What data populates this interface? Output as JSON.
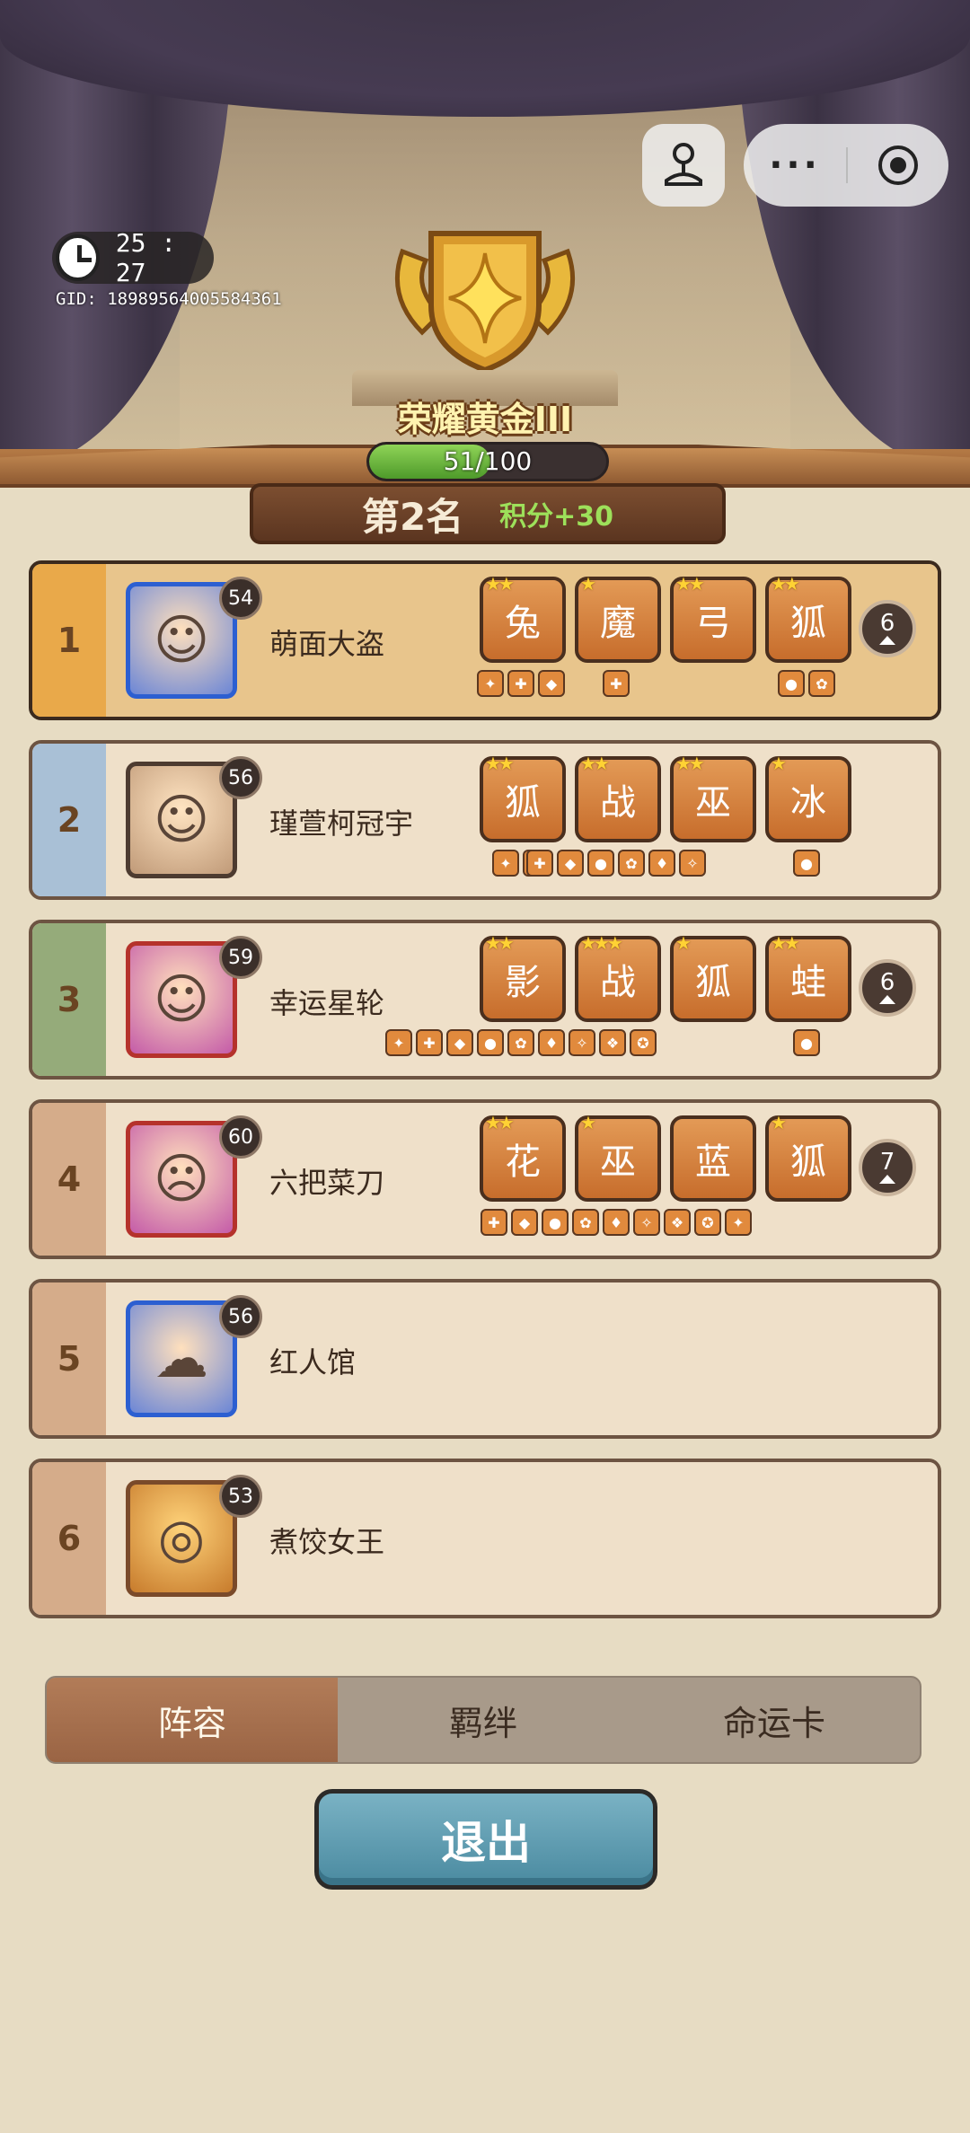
{
  "header": {
    "timer": "25 : 27",
    "gid": "GID: 18989564005584361",
    "rank_name": "荣耀黄金III",
    "xp": {
      "text": "51/100",
      "current": 51,
      "max": 100
    },
    "placement": "第2名",
    "score_change": "积分+30"
  },
  "capsule": {
    "game_icon": "joystick-icon",
    "more_label": "···",
    "close_icon": "target-icon"
  },
  "colors": {
    "rank1": "#e9a94a",
    "rank2": "#a9c0d6",
    "rank3": "#95ab7a",
    "rank4": "#d5ac8a",
    "rank5": "#d5ac8a",
    "rank6": "#d5ac8a",
    "accent_green": "#9de05a",
    "exit_button": "#5a9bb0"
  },
  "players": [
    {
      "rank": "1",
      "name": "萌面大盗",
      "level": "54",
      "count": "6",
      "highlight": true,
      "avatar_icon": "blonde-thief-avatar",
      "units": [
        {
          "stars": "★★",
          "glyph": "兔"
        },
        {
          "stars": "★",
          "glyph": "魔"
        },
        {
          "stars": "★★",
          "glyph": "弓"
        },
        {
          "stars": "★★",
          "glyph": "狐"
        }
      ],
      "items": [
        {
          "unit": 0,
          "n": 3
        },
        {
          "unit": 1,
          "n": 1
        },
        {
          "unit": 3,
          "n": 2
        }
      ]
    },
    {
      "rank": "2",
      "name": "瑾萱柯冠宇",
      "level": "56",
      "count": "",
      "highlight": false,
      "avatar_icon": "blonde-hero-avatar",
      "units": [
        {
          "stars": "★★",
          "glyph": "狐"
        },
        {
          "stars": "★★",
          "glyph": "战"
        },
        {
          "stars": "★★",
          "glyph": "巫"
        },
        {
          "stars": "★",
          "glyph": "冰"
        }
      ],
      "items": [
        {
          "unit": 0,
          "n": 2
        },
        {
          "unit": 1,
          "n": 6
        },
        {
          "unit": 3,
          "n": 1
        }
      ]
    },
    {
      "rank": "3",
      "name": "幸运星轮",
      "level": "59",
      "count": "6",
      "highlight": false,
      "avatar_icon": "blonde-jester-avatar",
      "units": [
        {
          "stars": "★★",
          "glyph": "影"
        },
        {
          "stars": "★★★",
          "glyph": "战"
        },
        {
          "stars": "★",
          "glyph": "狐"
        },
        {
          "stars": "★★",
          "glyph": "蛙"
        }
      ],
      "items": [
        {
          "unit": 0,
          "n": 9
        },
        {
          "unit": 3,
          "n": 1
        }
      ]
    },
    {
      "rank": "4",
      "name": "六把菜刀",
      "level": "60",
      "count": "7",
      "highlight": false,
      "avatar_icon": "duck-knight-avatar",
      "units": [
        {
          "stars": "★★",
          "glyph": "花"
        },
        {
          "stars": "★",
          "glyph": "巫"
        },
        {
          "stars": "",
          "glyph": "蓝"
        },
        {
          "stars": "★",
          "glyph": "狐"
        }
      ],
      "items": [
        {
          "unit": 1,
          "n": 9
        }
      ]
    },
    {
      "rank": "5",
      "name": "红人馆",
      "level": "56",
      "count": "",
      "highlight": false,
      "avatar_icon": "blue-swirl-avatar",
      "units": [],
      "items": []
    },
    {
      "rank": "6",
      "name": "煮饺女王",
      "level": "53",
      "count": "",
      "highlight": false,
      "avatar_icon": "mooncake-avatar",
      "units": [],
      "items": []
    }
  ],
  "tabs": [
    {
      "label": "阵容",
      "active": true
    },
    {
      "label": "羁绊",
      "active": false
    },
    {
      "label": "命运卡",
      "active": false
    }
  ],
  "exit_label": "退出"
}
